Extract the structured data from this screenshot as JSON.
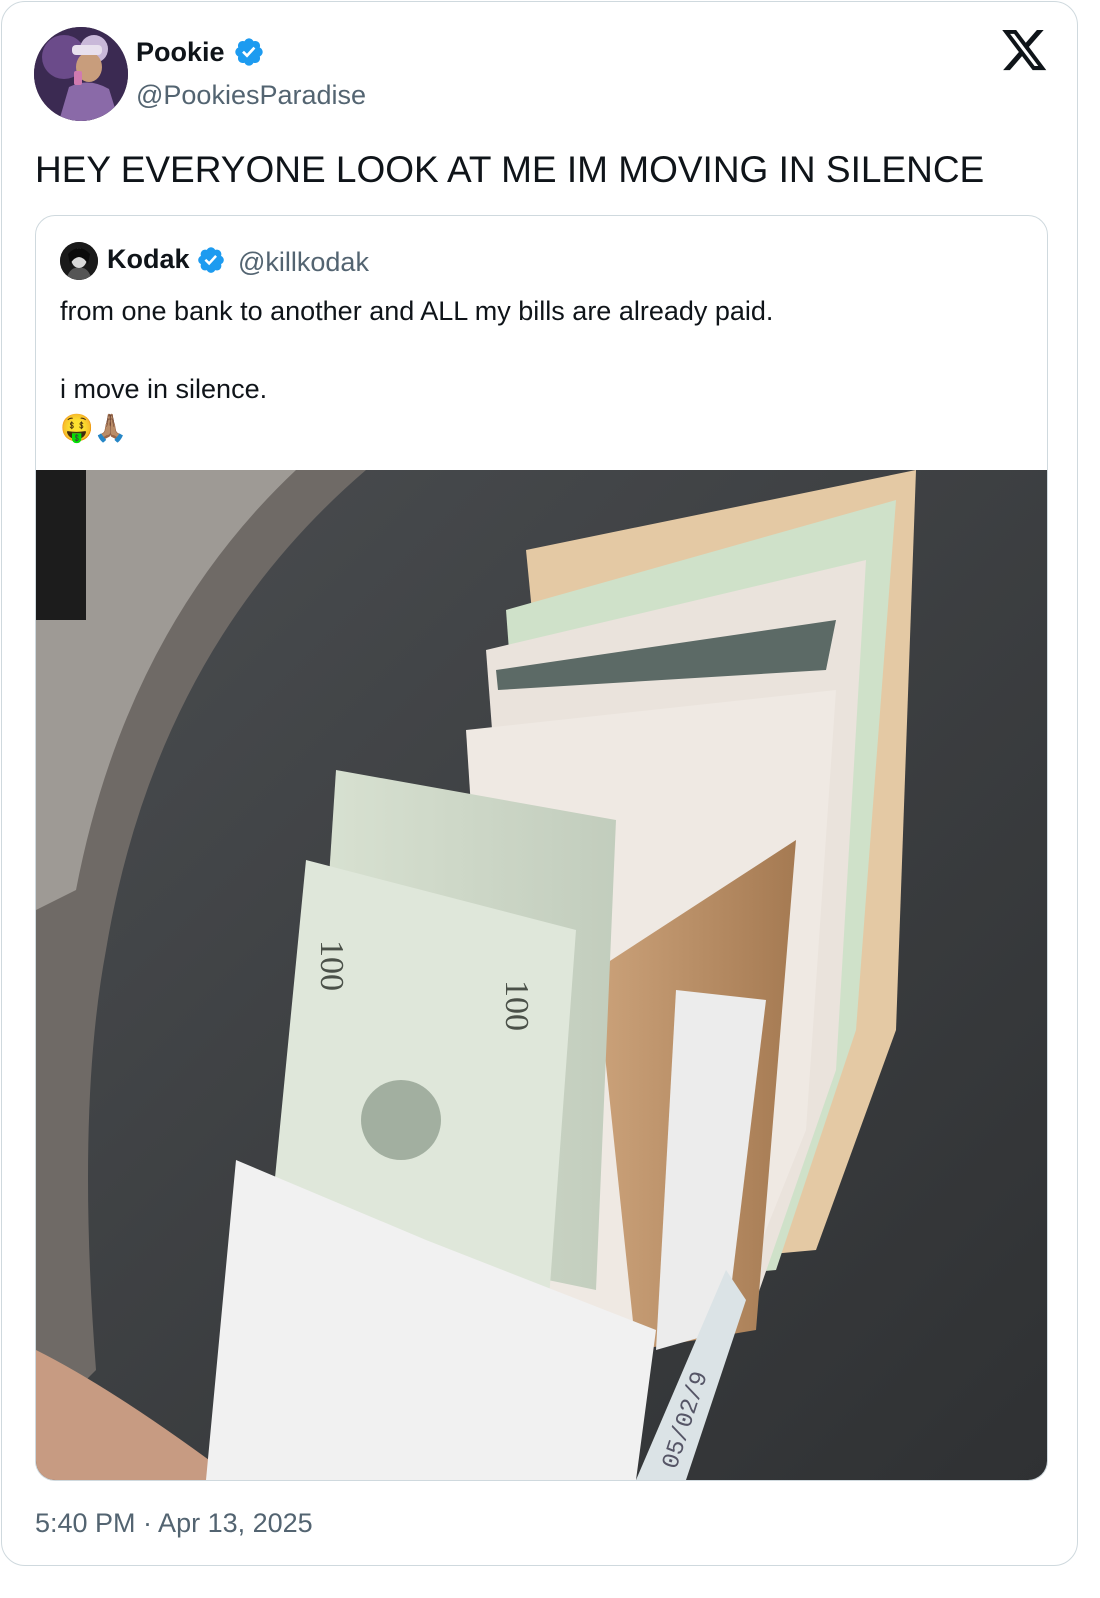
{
  "post": {
    "author_name": "Pookie",
    "author_handle": "@PookiesParadise",
    "text": "HEY EVERYONE LOOK AT ME IM MOVING IN SILENCE",
    "timestamp": "5:40 PM · Apr 13, 2025"
  },
  "quoted_post": {
    "author_name": "Kodak",
    "author_handle": "@killkodak",
    "text": "from one bank to another and ALL my bills are already paid.\n\ni move in silence.\n🤑🙏🏽"
  },
  "icons": {
    "verified": "verified-badge-icon",
    "platform": "x-logo-icon"
  },
  "colors": {
    "verified_blue": "#1d9bf0",
    "secondary_text": "#536471",
    "border": "#cfd9de"
  }
}
